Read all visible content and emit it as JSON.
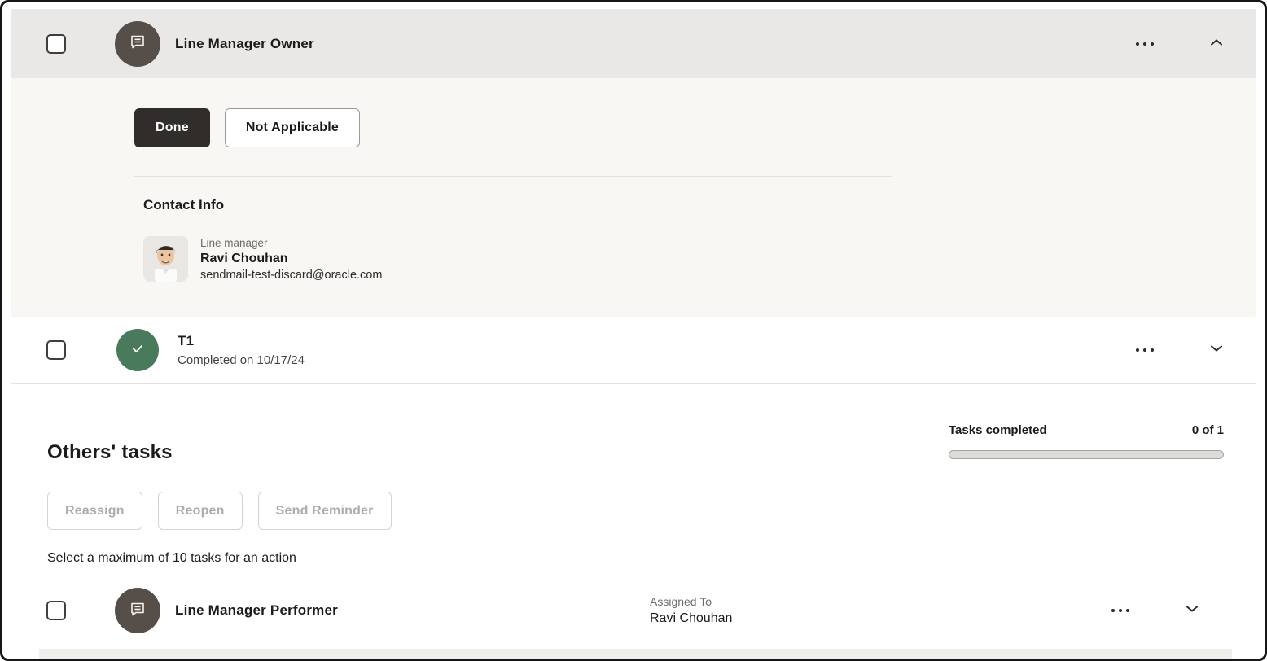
{
  "owner_task": {
    "title": "Line Manager Owner",
    "done_button": "Done",
    "not_applicable_button": "Not Applicable",
    "contact_info": {
      "heading": "Contact Info",
      "role": "Line manager",
      "name": "Ravi Chouhan",
      "email": "sendmail-test-discard@oracle.com"
    }
  },
  "t1_task": {
    "title": "T1",
    "status": "Completed on 10/17/24"
  },
  "others_tasks": {
    "heading": "Others' tasks",
    "progress_label": "Tasks completed",
    "progress_value": "0 of 1",
    "progress_percent": 0,
    "buttons": [
      "Reassign",
      "Reopen",
      "Send Reminder"
    ],
    "note": "Select a maximum of 10 tasks for an action"
  },
  "performer_task": {
    "title": "Line Manager Performer",
    "assigned_to_label": "Assigned To",
    "assigned_to": "Ravi Chouhan"
  },
  "icons": {
    "task_icon": "chat-bubble",
    "completed_icon": "checkmark",
    "menu_icon": "ellipsis",
    "collapse_icon": "chevron-up",
    "expand_icon": "chevron-down"
  },
  "colors": {
    "header_bg": "#e9e8e6",
    "panel_bg": "#f8f7f4",
    "dark_button_bg": "#312d2a",
    "completed_green": "#4a7a5c",
    "icon_circle_bg": "#564f49"
  }
}
